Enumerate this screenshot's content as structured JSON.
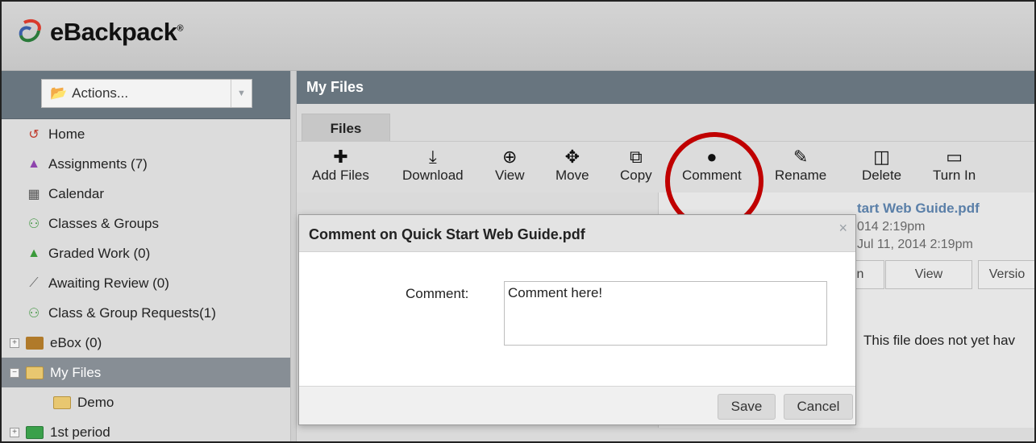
{
  "app": {
    "brand": "eBackpack",
    "brand_mark": "®",
    "colors": {
      "header_bar": "#68757f",
      "highlight": "#c00000",
      "link": "#5a7fa8"
    }
  },
  "sidebar": {
    "actions_label": "Actions...",
    "items": [
      {
        "label": "Home",
        "icon": "home-logo-icon"
      },
      {
        "label": "Assignments (7)",
        "icon": "assignments-icon"
      },
      {
        "label": "Calendar",
        "icon": "calendar-icon"
      },
      {
        "label": "Classes & Groups",
        "icon": "groups-icon"
      },
      {
        "label": "Graded Work (0)",
        "icon": "graded-work-icon"
      },
      {
        "label": "Awaiting Review (0)",
        "icon": "paperclip-icon"
      },
      {
        "label": "Class & Group Requests(1)",
        "icon": "requests-icon"
      },
      {
        "label": "eBox (0)",
        "icon": "ebox-icon"
      },
      {
        "label": "My Files",
        "icon": "folder-icon"
      },
      {
        "label": "Demo",
        "icon": "folder-icon"
      },
      {
        "label": "1st period",
        "icon": "folder-green-icon"
      }
    ]
  },
  "main": {
    "title": "My Files",
    "tab": "Files",
    "toolbar": [
      {
        "label": "Add Files",
        "icon": "plus-icon"
      },
      {
        "label": "Download",
        "icon": "download-icon"
      },
      {
        "label": "View",
        "icon": "zoom-icon"
      },
      {
        "label": "Move",
        "icon": "move-icon"
      },
      {
        "label": "Copy",
        "icon": "copy-icon"
      },
      {
        "label": "Comment",
        "icon": "comment-icon"
      },
      {
        "label": "Rename",
        "icon": "edit-icon"
      },
      {
        "label": "Delete",
        "icon": "trash-icon"
      },
      {
        "label": "Turn In",
        "icon": "inbox-icon"
      }
    ],
    "detail": {
      "title": "tart Web Guide.pdf",
      "created": "014 2:19pm",
      "modified": "Jul 11, 2014 2:19pm",
      "tabs": [
        "n",
        "View",
        "Versio"
      ],
      "message": "This file does not yet hav"
    }
  },
  "modal": {
    "title": "Comment on Quick Start Web Guide.pdf",
    "close": "×",
    "field_label": "Comment:",
    "comment_value": "Comment here!",
    "save_label": "Save",
    "cancel_label": "Cancel"
  }
}
